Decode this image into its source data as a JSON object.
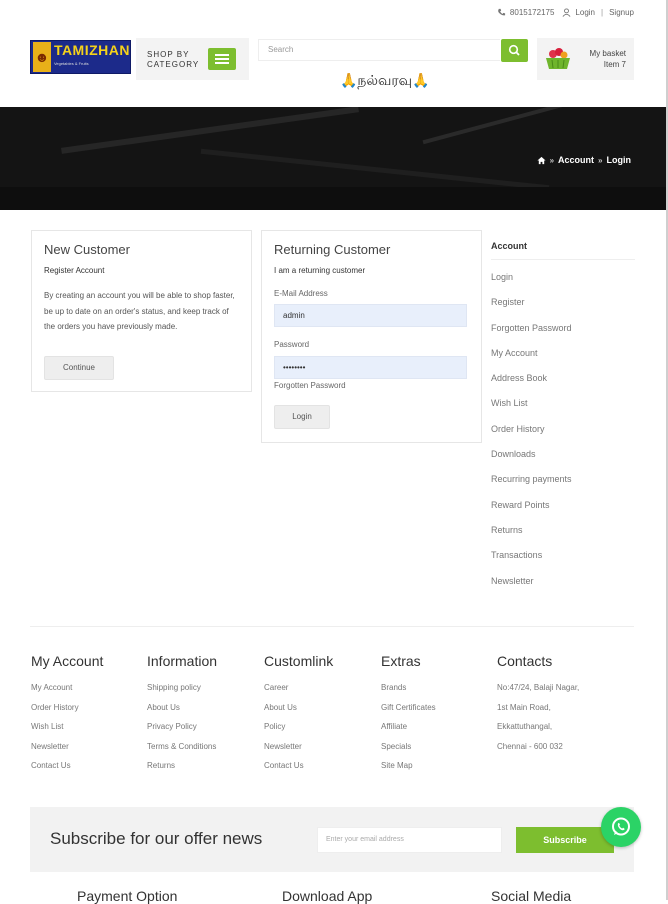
{
  "topbar": {
    "phone": "8015172175",
    "login": "Login",
    "separator": "|",
    "signup": "Signup"
  },
  "header": {
    "logo_text": "TAMIZHAN",
    "logo_sub": "Vegetables & Fruits",
    "shop_by_category": "SHOP BY CATEGORY",
    "search_placeholder": "Search",
    "basket_title": "My basket",
    "basket_items": "Item 7",
    "welcome": "🙏நல்வரவு🙏"
  },
  "breadcrumb": {
    "item1": "Account",
    "item2": "Login"
  },
  "new_customer": {
    "title": "New Customer",
    "subtitle": "Register Account",
    "text": "By creating an account you will be able to shop faster, be up to date on an order's status, and keep track of the orders you have previously made.",
    "button": "Continue"
  },
  "returning_customer": {
    "title": "Returning Customer",
    "subtitle": "I am a returning customer",
    "email_label": "E-Mail Address",
    "email_value": "admin",
    "password_label": "Password",
    "password_value": "••••••••",
    "forgot": "Forgotten Password",
    "button": "Login"
  },
  "account_menu": {
    "title": "Account",
    "items": [
      "Login",
      "Register",
      "Forgotten Password",
      "My Account",
      "Address Book",
      "Wish List",
      "Order History",
      "Downloads",
      "Recurring payments",
      "Reward Points",
      "Returns",
      "Transactions",
      "Newsletter"
    ]
  },
  "footer": {
    "columns": [
      {
        "title": "My Account",
        "items": [
          "My Account",
          "Order History",
          "Wish List",
          "Newsletter",
          "Contact Us"
        ]
      },
      {
        "title": "Information",
        "items": [
          "Shipping policy",
          "About Us",
          "Privacy Policy",
          "Terms & Conditions",
          "Returns"
        ]
      },
      {
        "title": "Customlink",
        "items": [
          "Career",
          "About Us",
          "Policy",
          "Newsletter",
          "Contact Us"
        ]
      },
      {
        "title": "Extras",
        "items": [
          "Brands",
          "Gift Certificates",
          "Affiliate",
          "Specials",
          "Site Map"
        ]
      },
      {
        "title": "Contacts",
        "items": [
          "No:47/24, Balaji Nagar,",
          "1st Main Road,",
          "Ekkattuthangal,",
          "Chennai - 600 032"
        ]
      }
    ]
  },
  "subscribe": {
    "title": "Subscribe for our offer news",
    "placeholder": "Enter your email address",
    "button": "Subscribe"
  },
  "bottom": {
    "payment": "Payment Option",
    "download": "Download App",
    "social": "Social Media"
  },
  "colors": {
    "accent": "#7dbe2f",
    "whatsapp": "#2bd366",
    "banner": "#141414"
  }
}
